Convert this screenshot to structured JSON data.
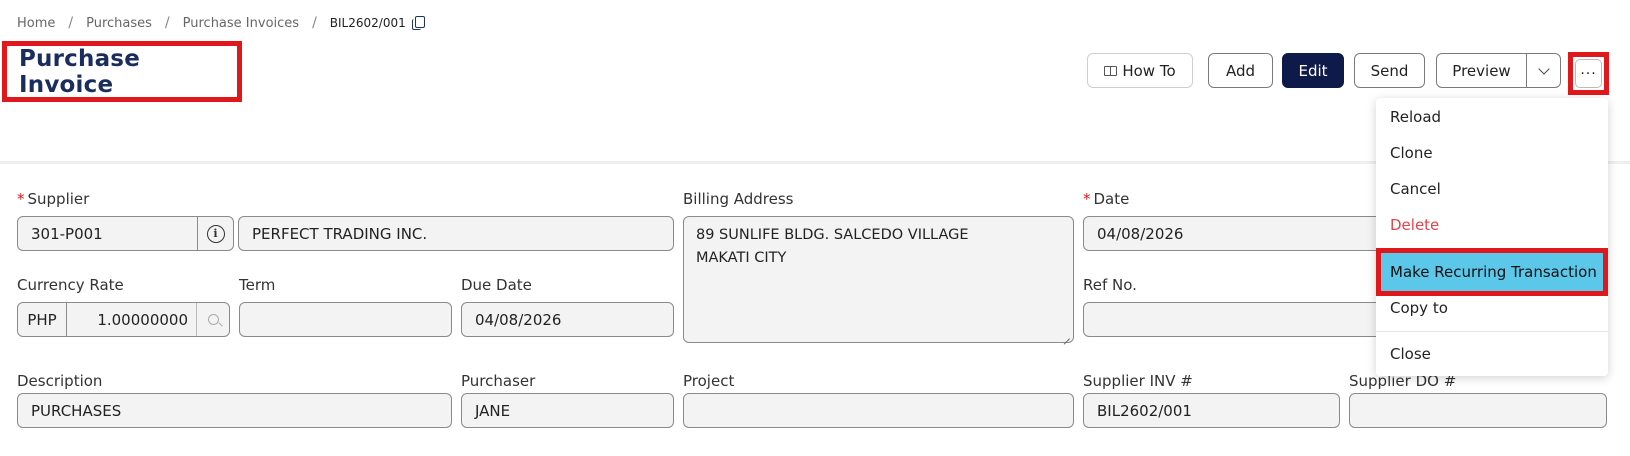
{
  "breadcrumb": {
    "items": [
      "Home",
      "Purchases",
      "Purchase Invoices"
    ],
    "separator": "/",
    "current": "BIL2602/001",
    "copy_icon": "copy-icon"
  },
  "header": {
    "title": "Purchase Invoice"
  },
  "toolbar": {
    "howto_label": "How To",
    "howto_icon": "book-icon",
    "add_label": "Add",
    "edit_label": "Edit",
    "send_label": "Send",
    "preview_label": "Preview",
    "caret_icon": "chevron-down-icon",
    "more_label": "···"
  },
  "form": {
    "supplier": {
      "label": "Supplier",
      "code": "301-P001",
      "name": "PERFECT TRADING INC.",
      "info_glyph": "i"
    },
    "billing_address": {
      "label": "Billing Address",
      "line1": "89 SUNLIFE BLDG.  SALCEDO VILLAGE",
      "line2": "MAKATI CITY"
    },
    "date": {
      "label": "Date",
      "value": "04/08/2026"
    },
    "currency_rate": {
      "label": "Currency Rate",
      "currency": "PHP",
      "rate": "1.00000000"
    },
    "term": {
      "label": "Term",
      "value": ""
    },
    "due_date": {
      "label": "Due Date",
      "value": "04/08/2026"
    },
    "ref_no": {
      "label": "Ref No.",
      "value": ""
    },
    "description": {
      "label": "Description",
      "value": "PURCHASES"
    },
    "purchaser": {
      "label": "Purchaser",
      "value": "JANE"
    },
    "project": {
      "label": "Project",
      "value": ""
    },
    "supplier_inv": {
      "label": "Supplier INV #",
      "value": "BIL2602/001"
    },
    "supplier_do": {
      "label": "Supplier DO #",
      "value": ""
    },
    "required_mark": "*"
  },
  "menu": {
    "reload": "Reload",
    "clone": "Clone",
    "cancel": "Cancel",
    "delete": "Delete",
    "make_recurring": "Make Recurring Transaction",
    "copy_to": "Copy to",
    "close": "Close"
  },
  "colors": {
    "highlight_border": "#e0181b",
    "primary_button": "#0e1a4a",
    "title": "#1a2d5e",
    "menu_highlight": "#5bc8ea",
    "delete_text": "#e8424a"
  }
}
